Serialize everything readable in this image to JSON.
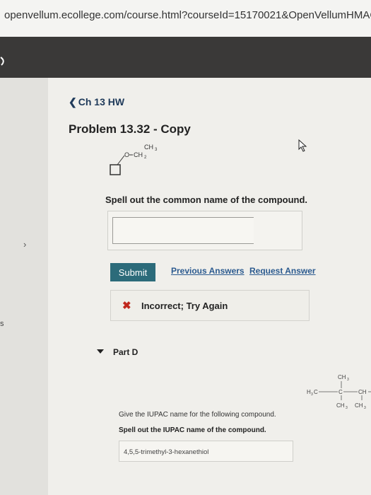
{
  "browser": {
    "url": "openvellum.ecollege.com/course.html?courseId=15170021&OpenVellumHMAC="
  },
  "nav": {
    "back_label": "Ch 13 HW"
  },
  "problem": {
    "title": "Problem 13.32 - Copy",
    "molecule": {
      "o_label": "O",
      "ch2_label": "CH",
      "ch2_sub": "2",
      "ch3_label": "CH",
      "ch3_sub": "3"
    }
  },
  "part_c": {
    "prompt": "Spell out the common name of the compound.",
    "answer_value": "",
    "submit_label": "Submit",
    "previous_answers_label": "Previous Answers",
    "request_answer_label": "Request Answer",
    "feedback": "Incorrect; Try Again"
  },
  "part_d": {
    "label": "Part D",
    "instruction": "Give the IUPAC name for the following compound.",
    "sub_instruction": "Spell out the IUPAC name of the compound.",
    "answer_value": "4,5,5-trimethyl-3-hexanethiol",
    "structure": {
      "top": "CH",
      "top_sub": "3",
      "left": "H",
      "left_sub": "3",
      "left_tail": "C",
      "center": "C",
      "right": "CH",
      "bottom_left": "CH",
      "bottom_left_sub": "3",
      "bottom_right": "CH",
      "bottom_right_sub": "3"
    }
  },
  "colors": {
    "submit_bg": "#2c6b7a",
    "link": "#2b5a8f",
    "error": "#c0281e"
  }
}
